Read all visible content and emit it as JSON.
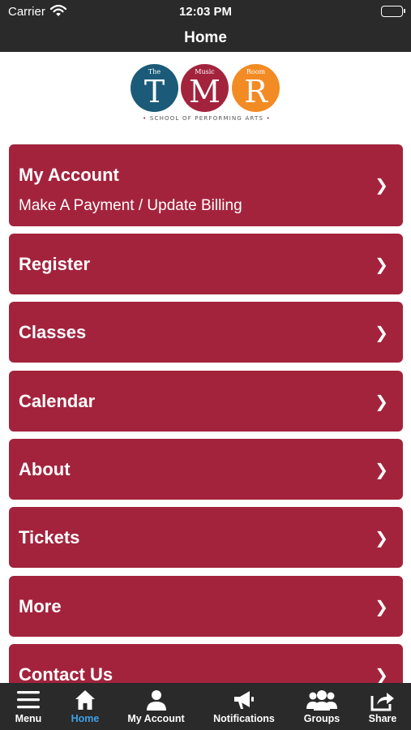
{
  "status_bar": {
    "carrier": "Carrier",
    "time": "12:03 PM"
  },
  "nav": {
    "title": "Home"
  },
  "logo": {
    "letters": [
      "T",
      "M",
      "R"
    ],
    "small_words": [
      "The",
      "Music",
      "Room"
    ],
    "tagline": "SCHOOL OF PERFORMING ARTS",
    "dot": "•"
  },
  "menu": [
    {
      "label": "My Account",
      "sublabel": "Make A Payment / Update Billing"
    },
    {
      "label": "Register"
    },
    {
      "label": "Classes"
    },
    {
      "label": "Calendar"
    },
    {
      "label": "About"
    },
    {
      "label": "Tickets"
    },
    {
      "label": "More"
    },
    {
      "label": "Contact Us"
    }
  ],
  "chevron": "❯",
  "tabs": [
    {
      "label": "Menu",
      "icon": "hamburger-icon",
      "active": false
    },
    {
      "label": "Home",
      "icon": "home-icon",
      "active": true
    },
    {
      "label": "My Account",
      "icon": "user-icon",
      "active": false
    },
    {
      "label": "Notifications",
      "icon": "megaphone-icon",
      "active": false
    },
    {
      "label": "Groups",
      "icon": "group-icon",
      "active": false
    },
    {
      "label": "Share",
      "icon": "share-icon",
      "active": false
    }
  ],
  "colors": {
    "accent": "#a3233d",
    "bar": "#2a2a2a",
    "active_tab": "#3ea0e6",
    "logo_blue": "#1b5b79",
    "logo_orange": "#f28b24"
  }
}
